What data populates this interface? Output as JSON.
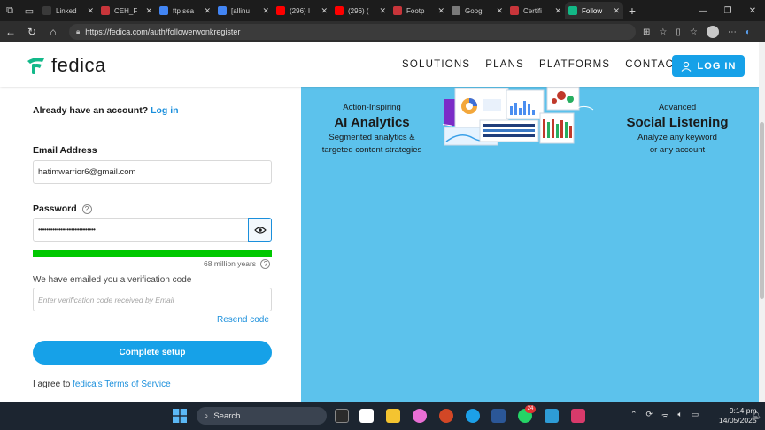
{
  "browser": {
    "tabs": [
      {
        "title": "Linked",
        "color": "#3a3a3a"
      },
      {
        "title": "CEH_F",
        "color": "#c8353a"
      },
      {
        "title": "ftp sea",
        "color": "#4285f4"
      },
      {
        "title": "[allinu",
        "color": "#4285f4"
      },
      {
        "title": "(296) I",
        "color": "#ff0000"
      },
      {
        "title": "(296) (",
        "color": "#ff0000"
      },
      {
        "title": "Footp",
        "color": "#c8353a"
      },
      {
        "title": "Googl",
        "color": "#7a7a7a"
      },
      {
        "title": "Certifi",
        "color": "#c8353a"
      },
      {
        "title": "Follow",
        "color": "#12b886"
      }
    ],
    "url": "https://fedica.com/auth/followerwonkregister"
  },
  "header": {
    "logo": "fedica",
    "nav": [
      "SOLUTIONS",
      "PLANS",
      "PLATFORMS",
      "CONTACT"
    ],
    "login_label": "LOG IN"
  },
  "form": {
    "account_prompt": "Already have an account?",
    "account_link": "Log in",
    "email_label": "Email Address",
    "email_value": "hatimwarrior6@gmail.com",
    "password_label": "Password",
    "password_value": "••••••••••••••••••••••••••••",
    "strength_text": "68 million years",
    "verification_text": "We have emailed you a verification code",
    "verification_placeholder": "Enter verification code received by Email",
    "resend_label": "Resend code",
    "complete_label": "Complete setup",
    "terms_prefix": "I agree to",
    "terms_link": "fedica's Terms of Service"
  },
  "promo": {
    "left": {
      "small": "Action-Inspiring",
      "big": "AI Analytics",
      "sub1": "Segmented analytics &",
      "sub2": "targeted content strategies"
    },
    "right": {
      "small": "Advanced",
      "big": "Social Listening",
      "sub1": "Analyze any keyword",
      "sub2": "or any account"
    }
  },
  "taskbar": {
    "search_label": "Search",
    "notification_count": "24",
    "time": "9:14 pm",
    "date": "14/05/2025"
  },
  "colors": {
    "accent": "#16a1e8",
    "promo_bg": "#5cc2ec",
    "strength": "#00c800"
  }
}
